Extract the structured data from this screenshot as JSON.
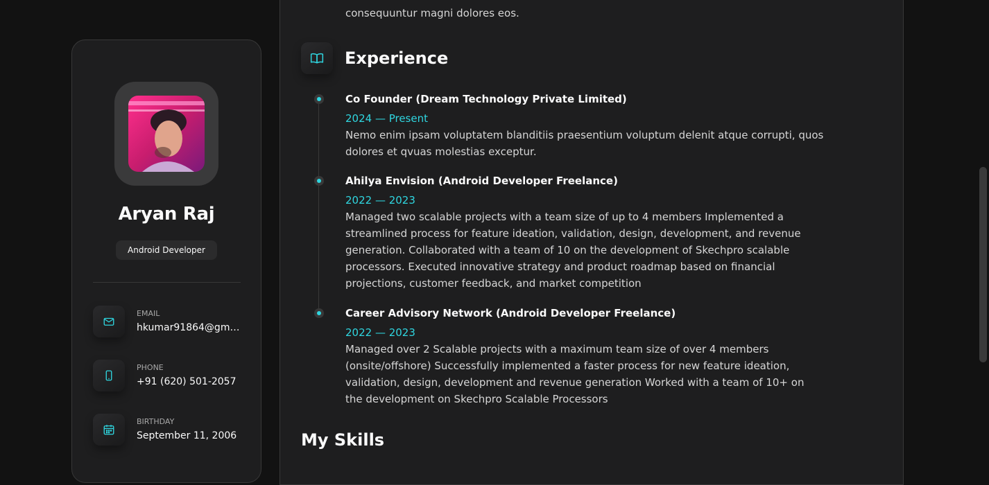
{
  "profile": {
    "name": "Aryan Raj",
    "title": "Android Developer",
    "avatar_alt": "Aryan Raj avatar"
  },
  "contacts": [
    {
      "icon": "mail-icon",
      "label": "EMAIL",
      "value": "hkumar91864@gma..."
    },
    {
      "icon": "phone-icon",
      "label": "PHONE",
      "value": "+91 (620) 501-2057"
    },
    {
      "icon": "calendar-icon",
      "label": "BIRTHDAY",
      "value": "September 11, 2006"
    }
  ],
  "about": {
    "trailing_text": "consequuntur magni dolores eos."
  },
  "experience": {
    "title": "Experience",
    "items": [
      {
        "company": "Co Founder (Dream Technology Private Limited)",
        "dates": "2024 — Present",
        "description": "Nemo enim ipsam voluptatem blanditiis praesentium voluptum delenit atque corrupti, quos dolores et qvuas molestias exceptur."
      },
      {
        "company": "Ahilya Envision (Android Developer Freelance)",
        "dates": "2022 — 2023",
        "description": "Managed two scalable projects with a team size of up to 4 members Implemented a streamlined process for feature ideation, validation, design, development, and revenue generation. Collaborated with a team of 10 on the development of Skechpro scalable processors. Executed innovative strategy and product roadmap based on financial projections, customer feedback, and market competition"
      },
      {
        "company": "Career Advisory Network (Android Developer Freelance)",
        "dates": "2022 — 2023",
        "description": "Managed over 2 Scalable projects with a maximum team size of over 4 members (onsite/offshore) Successfully implemented a faster process for new feature ideation, validation, design, development and revenue generation Worked with a team of 10+ on the development on Skechpro Scalable Processors"
      }
    ]
  },
  "skills": {
    "title": "My Skills"
  },
  "colors": {
    "accent": "#2fd6e0",
    "background": "#121212",
    "card": "#1e1e1f",
    "border": "#383838"
  }
}
